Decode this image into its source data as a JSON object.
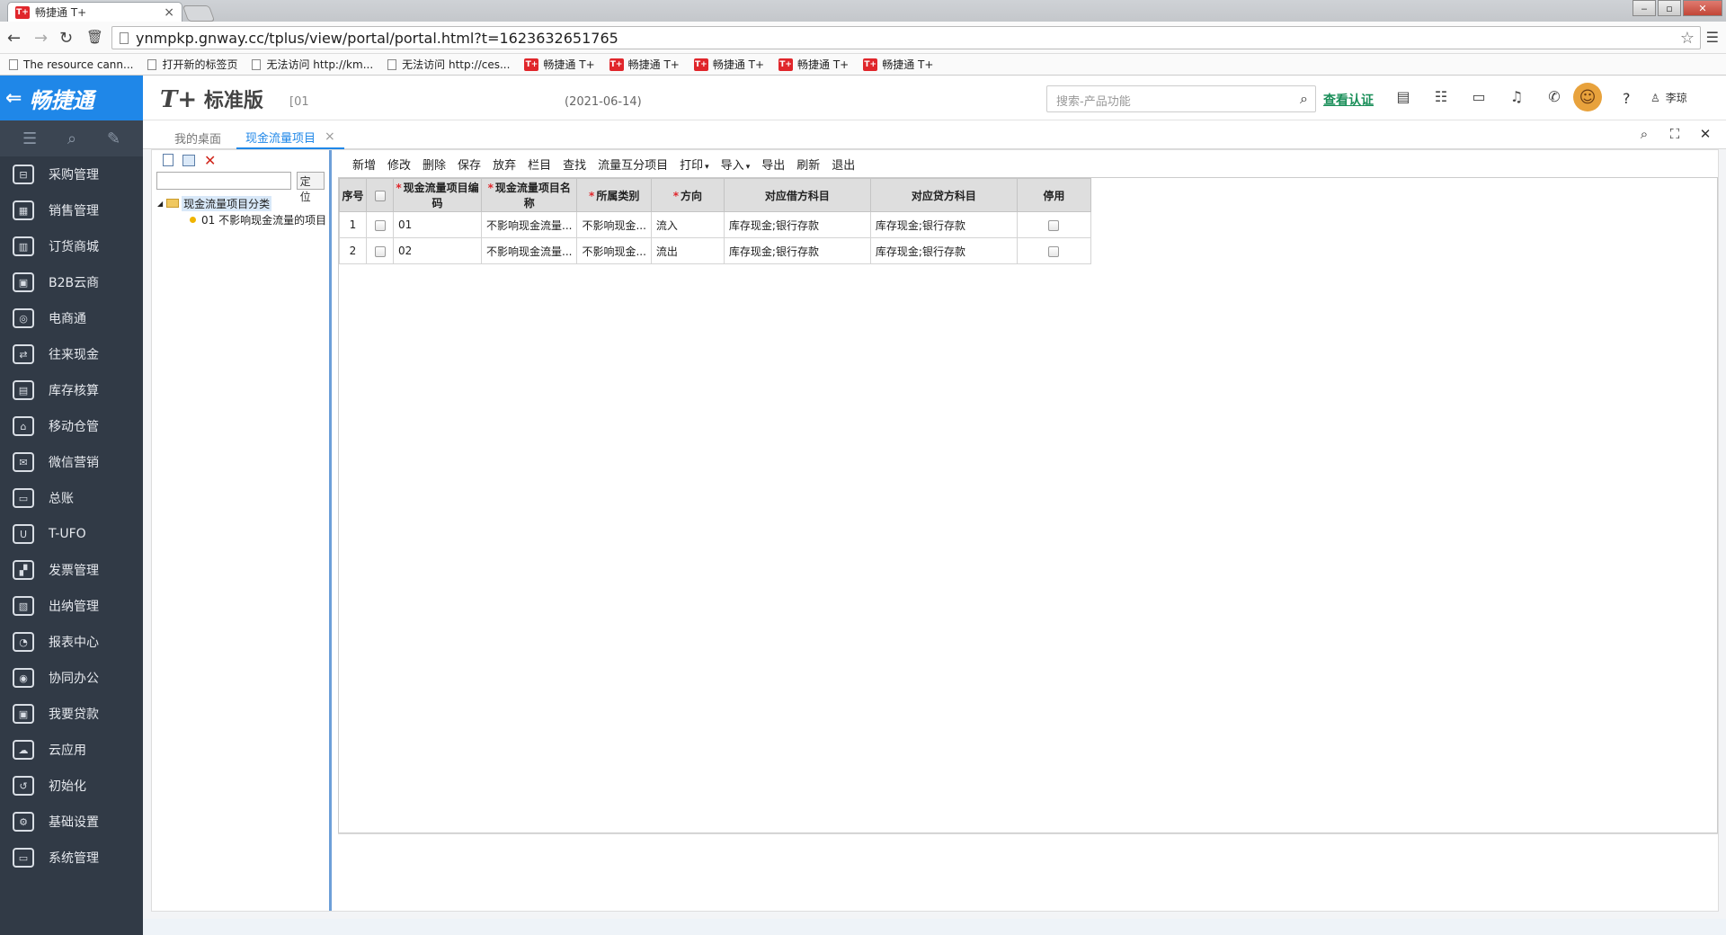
{
  "browser": {
    "tab_title": "畅捷通 T+",
    "tab_logo": "T+",
    "url": "ynmpkp.gnway.cc/tplus/view/portal/portal.html?t=1623632651765",
    "bookmarks": [
      {
        "label": "The resource cann...",
        "kind": "page"
      },
      {
        "label": "打开新的标签页",
        "kind": "page"
      },
      {
        "label": "无法访问 http://km...",
        "kind": "page"
      },
      {
        "label": "无法访问 http://ces...",
        "kind": "page"
      },
      {
        "label": "畅捷通 T+",
        "kind": "tplus"
      },
      {
        "label": "畅捷通 T+",
        "kind": "tplus"
      },
      {
        "label": "畅捷通 T+",
        "kind": "tplus"
      },
      {
        "label": "畅捷通 T+",
        "kind": "tplus"
      },
      {
        "label": "畅捷通 T+",
        "kind": "tplus"
      }
    ]
  },
  "header": {
    "brand": "畅捷通",
    "product_logo": "T+",
    "product": "标准版",
    "account": "[01",
    "date": "(2021-06-14)",
    "search_placeholder": "搜索-产品功能",
    "verify_link": "查看认证",
    "user_name": "李琼"
  },
  "sidebar": {
    "items": [
      {
        "label": "采购管理",
        "icon": "purchase-icon"
      },
      {
        "label": "销售管理",
        "icon": "sales-chart-icon"
      },
      {
        "label": "订货商城",
        "icon": "store-icon"
      },
      {
        "label": "B2B云商",
        "icon": "b2b-bag-icon"
      },
      {
        "label": "电商通",
        "icon": "ecommerce-icon"
      },
      {
        "label": "往来现金",
        "icon": "exchange-icon"
      },
      {
        "label": "库存核算",
        "icon": "inventory-icon"
      },
      {
        "label": "移动仓管",
        "icon": "mobile-warehouse-icon"
      },
      {
        "label": "微信营销",
        "icon": "wechat-icon"
      },
      {
        "label": "总账",
        "icon": "ledger-icon"
      },
      {
        "label": "T-UFO",
        "icon": "ufo-icon"
      },
      {
        "label": "发票管理",
        "icon": "invoice-icon"
      },
      {
        "label": "出纳管理",
        "icon": "cashier-icon"
      },
      {
        "label": "报表中心",
        "icon": "report-pie-icon"
      },
      {
        "label": "协同办公",
        "icon": "collab-icon"
      },
      {
        "label": "我要贷款",
        "icon": "loan-icon"
      },
      {
        "label": "云应用",
        "icon": "cloud-icon"
      },
      {
        "label": "初始化",
        "icon": "init-refresh-icon"
      },
      {
        "label": "基础设置",
        "icon": "settings-gear-icon"
      },
      {
        "label": "系统管理",
        "icon": "system-monitor-icon"
      }
    ]
  },
  "page_tabs": {
    "home": "我的桌面",
    "active": "现金流量项目"
  },
  "tree": {
    "locate_button": "定位",
    "root": "现金流量项目分类",
    "child": "01 不影响现金流量的项目"
  },
  "toolbar": [
    {
      "label": "新增",
      "enabled": true
    },
    {
      "label": "修改",
      "enabled": true
    },
    {
      "label": "删除",
      "enabled": true
    },
    {
      "label": "保存",
      "enabled": false
    },
    {
      "label": "放弃",
      "enabled": false
    },
    {
      "label": "栏目",
      "enabled": true
    },
    {
      "label": "查找",
      "enabled": true
    },
    {
      "label": "流量互分项目",
      "enabled": true
    },
    {
      "label": "打印",
      "enabled": true,
      "dropdown": true
    },
    {
      "label": "导入",
      "enabled": true,
      "dropdown": true
    },
    {
      "label": "导出",
      "enabled": true
    },
    {
      "label": "刷新",
      "enabled": true
    },
    {
      "label": "退出",
      "enabled": true
    }
  ],
  "grid": {
    "columns": [
      {
        "label": "序号",
        "required": false
      },
      {
        "label": "",
        "required": false,
        "checkbox": true
      },
      {
        "label": "现金流量项目编码",
        "required": true
      },
      {
        "label": "现金流量项目名称",
        "required": true
      },
      {
        "label": "所属类别",
        "required": true
      },
      {
        "label": "方向",
        "required": true
      },
      {
        "label": "对应借方科目",
        "required": false
      },
      {
        "label": "对应贷方科目",
        "required": false
      },
      {
        "label": "停用",
        "required": false
      }
    ],
    "rows": [
      {
        "no": "1",
        "code": "01",
        "name": "不影响现金流量...",
        "category": "不影响现金...",
        "direction": "流入",
        "debit": "库存现金;银行存款",
        "credit": "库存现金;银行存款",
        "disabled": false
      },
      {
        "no": "2",
        "code": "02",
        "name": "不影响现金流量...",
        "category": "不影响现金...",
        "direction": "流出",
        "debit": "库存现金;银行存款",
        "credit": "库存现金;银行存款",
        "disabled": false
      }
    ]
  }
}
